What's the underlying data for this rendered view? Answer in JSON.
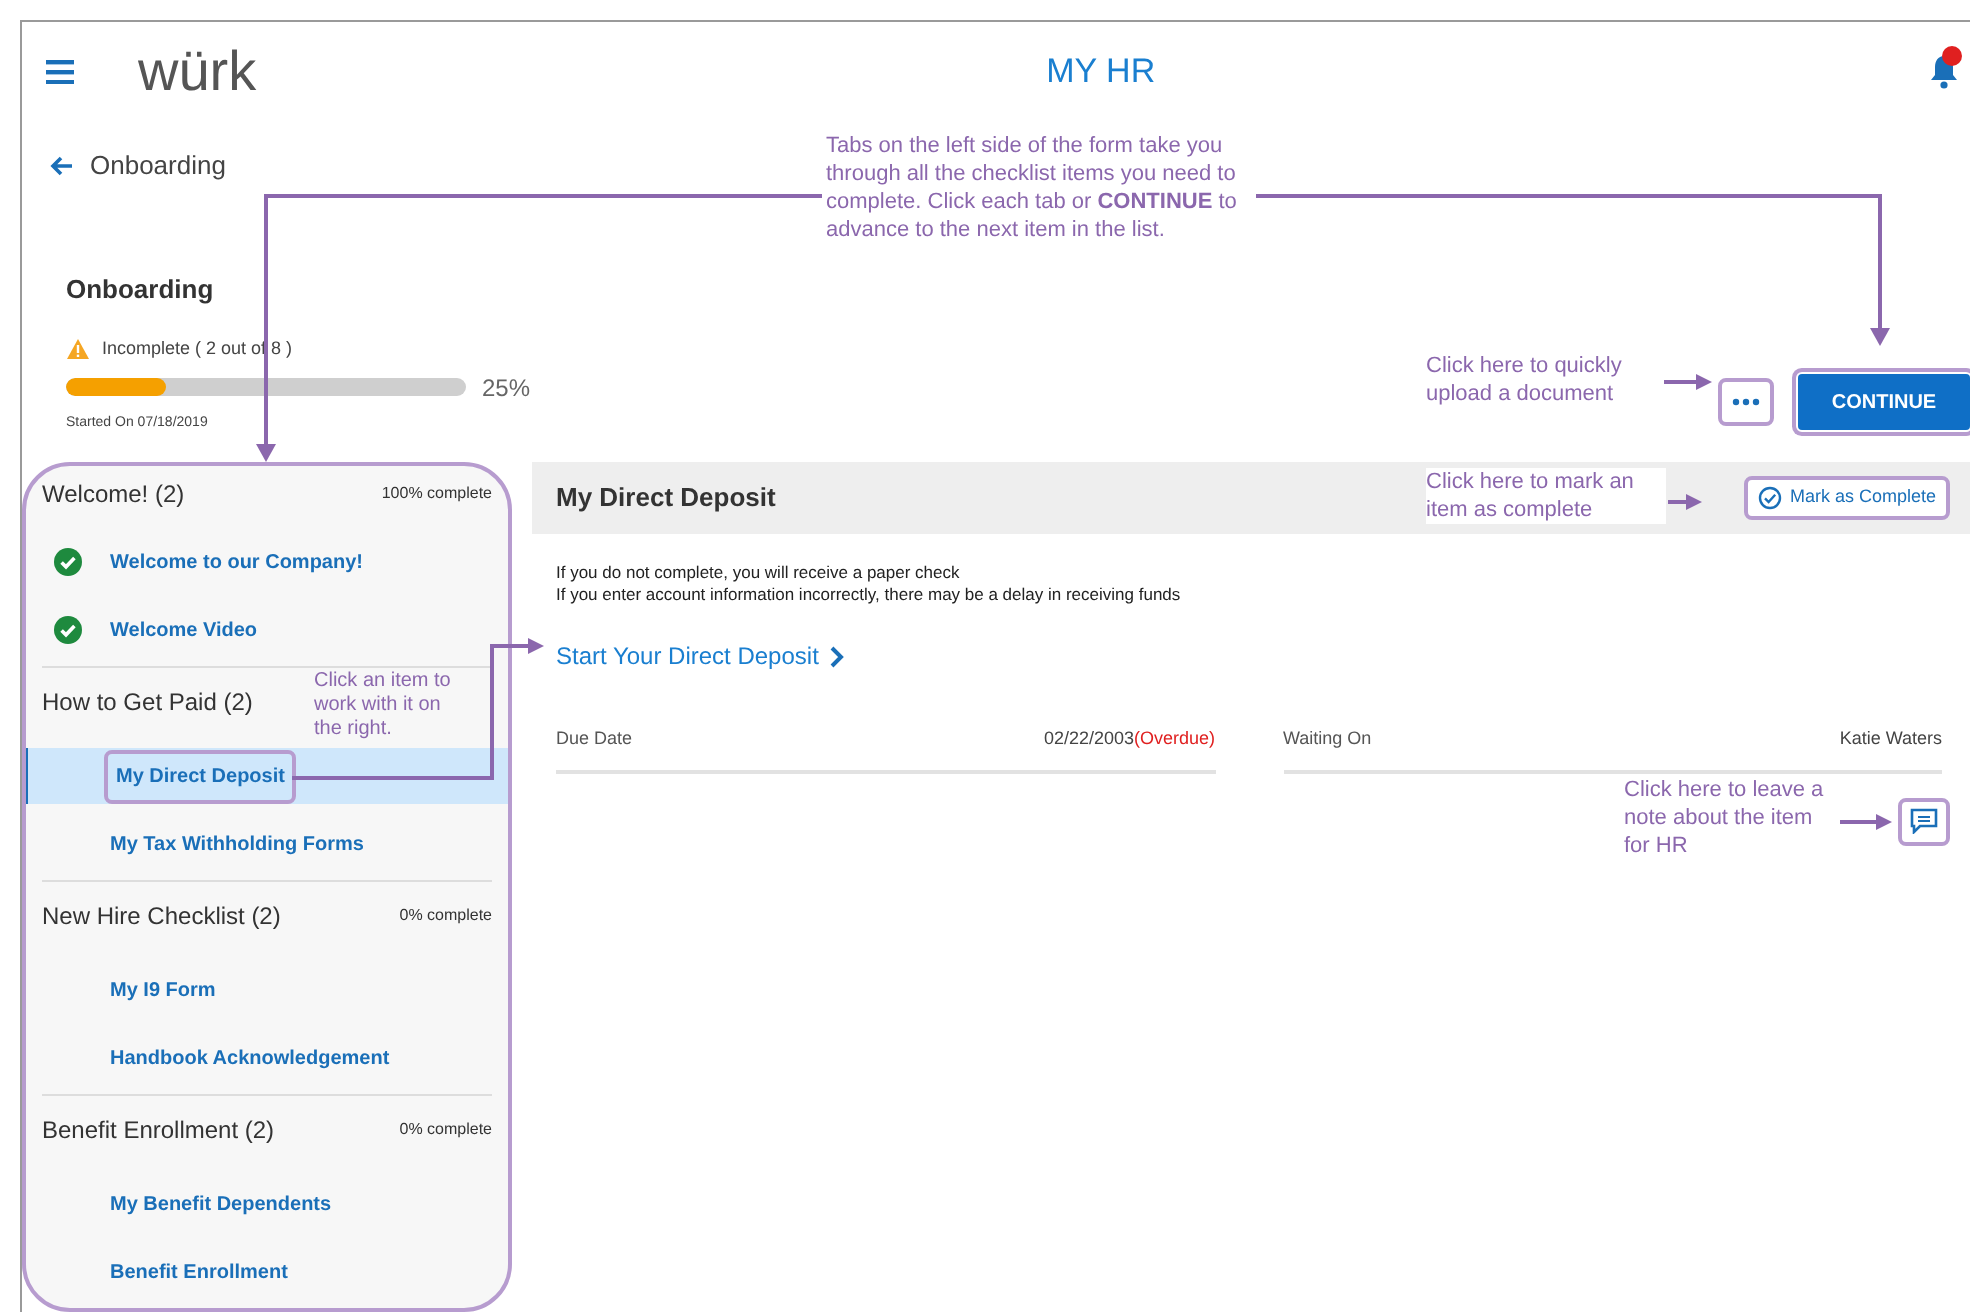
{
  "header": {
    "logo": "würk",
    "title": "MY HR"
  },
  "back_link": "Onboarding",
  "summary": {
    "title": "Onboarding",
    "status": "Incomplete ( 2 out of 8 )",
    "level": 0.25,
    "percent": "25%",
    "started": "Started On 07/18/2019"
  },
  "actions": {
    "continue": "CONTINUE"
  },
  "sidebar": {
    "groups": [
      {
        "title": "Welcome! (2)",
        "progress": "100% complete",
        "items": [
          {
            "label": "Welcome to our Company!",
            "done": true,
            "selected": false
          },
          {
            "label": "Welcome Video",
            "done": true,
            "selected": false
          }
        ]
      },
      {
        "title": "How to Get Paid (2)",
        "items": [
          {
            "label": "My Direct Deposit",
            "done": false,
            "selected": true
          },
          {
            "label": "My Tax Withholding Forms",
            "done": false,
            "selected": false
          }
        ]
      },
      {
        "title": "New Hire Checklist (2)",
        "progress": "0% complete",
        "items": [
          {
            "label": "My I9 Form",
            "done": false,
            "selected": false
          },
          {
            "label": "Handbook Acknowledgement",
            "done": false,
            "selected": false
          }
        ]
      },
      {
        "title": "Benefit Enrollment (2)",
        "progress": "0% complete",
        "items": [
          {
            "label": "My Benefit Dependents",
            "done": false,
            "selected": false
          },
          {
            "label": "Benefit Enrollment",
            "done": false,
            "selected": false
          }
        ]
      }
    ]
  },
  "detail": {
    "title": "My Direct Deposit",
    "mark_complete": "Mark as Complete",
    "notes": [
      "If you do not complete, you will receive a paper check",
      "If you enter account information incorrectly, there may be a delay in receiving funds"
    ],
    "link": "Start Your Direct Deposit",
    "fields": [
      {
        "label": "Due Date",
        "value": "02/22/2003",
        "flag": "(Overdue)"
      },
      {
        "label": "Waiting On",
        "value": "Katie Waters"
      }
    ]
  },
  "annotations": [
    {
      "text": "Tabs on the left side of the form take you through all the checklist items you need to complete. Click each tab or **CONTINUE** to advance to the next item in the list."
    },
    {
      "text": "Click here to quickly upload a document"
    },
    {
      "text": "Click here to mark an item as complete"
    },
    {
      "text": "Click an item to work with it on the right."
    },
    {
      "text": "Click here to leave a note about the item for HR"
    }
  ]
}
